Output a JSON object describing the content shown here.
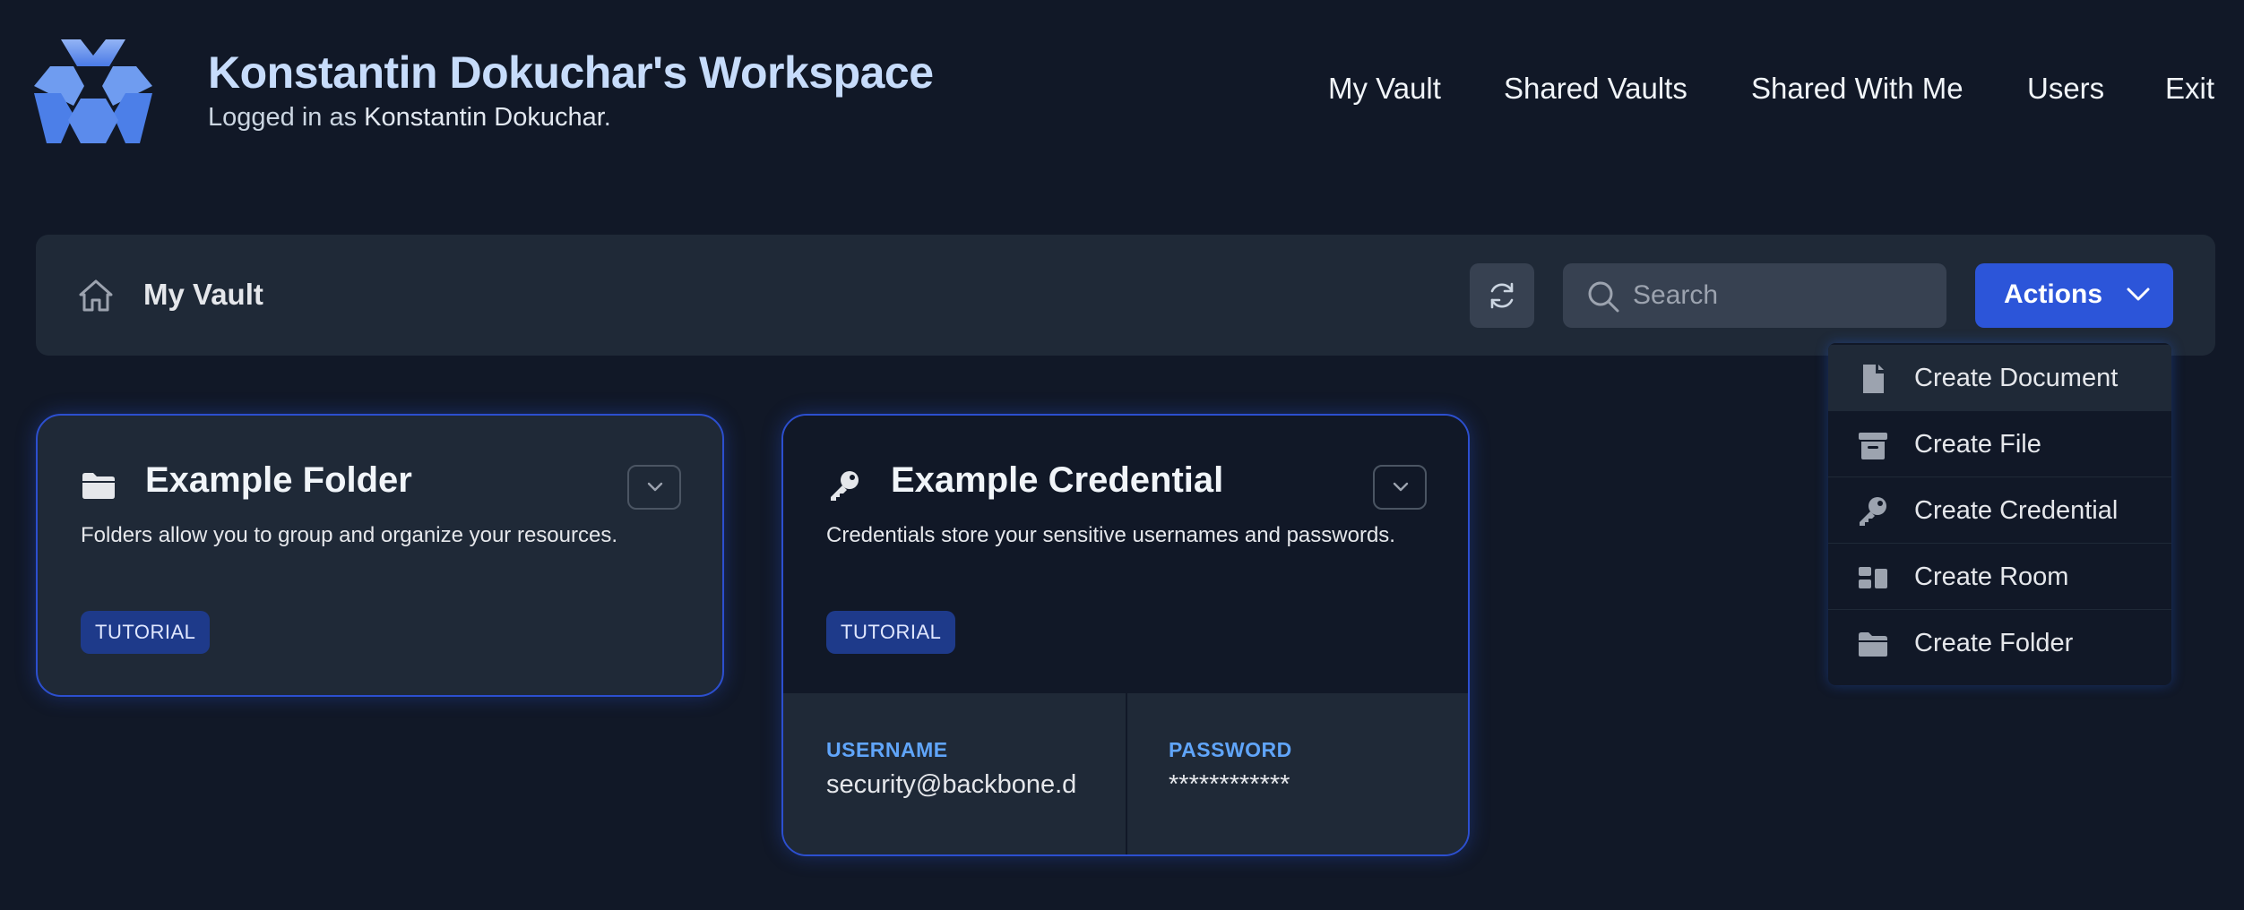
{
  "header": {
    "workspace_title": "Konstantin Dokuchar's Workspace",
    "logged_in_prefix": "Logged in as ",
    "user_name": "Konstantin Dokuchar",
    "logged_in_suffix": ".",
    "nav": [
      "My Vault",
      "Shared Vaults",
      "Shared With Me",
      "Users",
      "Exit"
    ]
  },
  "toolbar": {
    "title": "My Vault",
    "search_placeholder": "Search",
    "actions_label": "Actions"
  },
  "actions_menu": {
    "items": [
      {
        "label": "Create Document",
        "icon": "document-icon",
        "highlighted": true
      },
      {
        "label": "Create File",
        "icon": "archive-box-icon",
        "highlighted": false
      },
      {
        "label": "Create Credential",
        "icon": "key-icon",
        "highlighted": false
      },
      {
        "label": "Create Room",
        "icon": "room-icon",
        "highlighted": false
      },
      {
        "label": "Create Folder",
        "icon": "folder-icon",
        "highlighted": false
      }
    ]
  },
  "cards": [
    {
      "title": "Example Folder",
      "icon": "folder-icon",
      "description": "Folders allow you to group and organize your resources.",
      "tag": "TUTORIAL"
    },
    {
      "title": "Example Credential",
      "icon": "key-icon",
      "description": "Credentials store your sensitive usernames and passwords.",
      "tag": "TUTORIAL",
      "username_label": "USERNAME",
      "username_value": "security@backbone.d",
      "password_label": "PASSWORD",
      "password_value": "************"
    }
  ],
  "colors": {
    "background": "#111827",
    "panel": "#1f2937",
    "accent": "#2c55d9",
    "title": "#c7dcfb",
    "field_label": "#60a5fa"
  }
}
